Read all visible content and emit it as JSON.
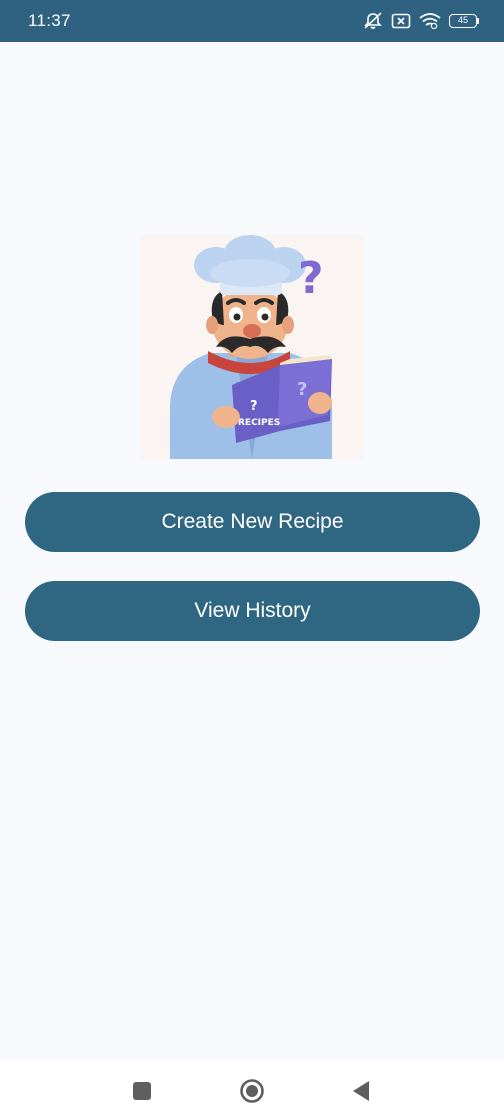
{
  "status_bar": {
    "time": "11:37",
    "battery": "45",
    "icons": [
      "mute-icon",
      "sim-error-icon",
      "wifi-icon",
      "battery-icon"
    ]
  },
  "main": {
    "illustration_text": "RECIPES",
    "buttons": {
      "create": "Create New Recipe",
      "history": "View History"
    }
  },
  "nav_bar": {
    "icons": [
      "recent-apps-icon",
      "home-icon",
      "back-icon"
    ]
  },
  "colors": {
    "status_bar": "#2f6180",
    "button": "#2f6682",
    "background": "#f7f9fd",
    "button_text": "#ffffff"
  }
}
